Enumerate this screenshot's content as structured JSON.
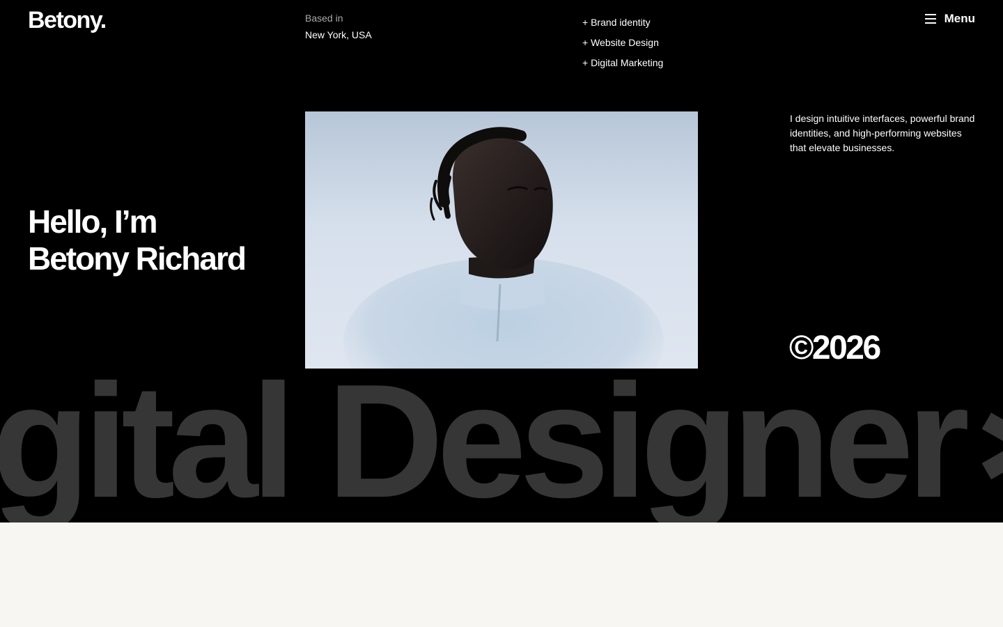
{
  "header": {
    "logo": "Betony.",
    "location_label": "Based in",
    "location_value": "New York, USA",
    "services": [
      "+ Brand identity",
      "+ Website Design",
      "+ Digital Marketing"
    ],
    "menu_label": "Menu"
  },
  "hero": {
    "headline_line1": "Hello, I’m",
    "headline_line2": "Betony Richard",
    "intro": "I design intuitive interfaces, powerful brand identities, and high-performing websites that elevate businesses.",
    "copyright": "©2026",
    "marquee": "gital Designer∗A"
  },
  "colors": {
    "hero_background": "#000000",
    "marquee_text": "#363636",
    "page_background": "#f7f6f3"
  },
  "icons": [
    "hamburger-icon"
  ]
}
